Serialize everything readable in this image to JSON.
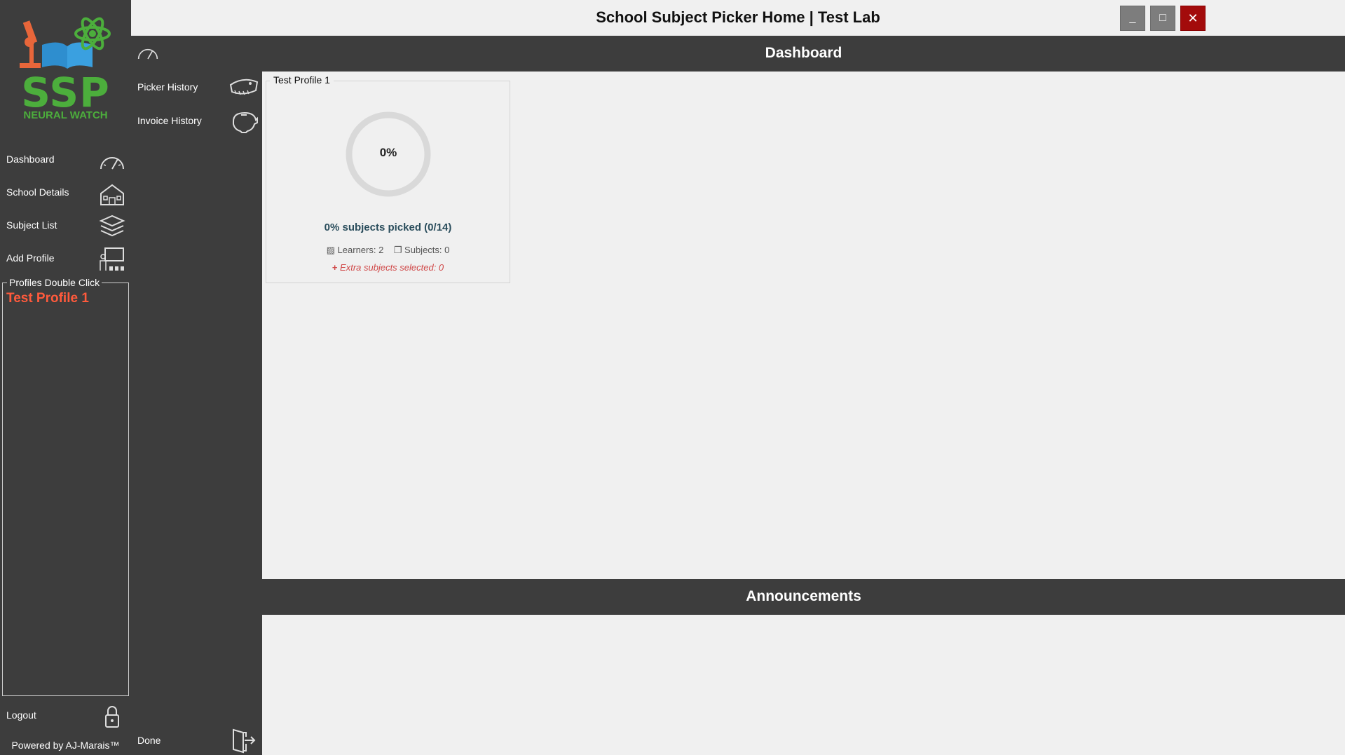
{
  "window": {
    "title": "School Subject Picker Home | Test Lab",
    "minimize_label": "_",
    "maximize_label": "□",
    "close_label": "✕"
  },
  "logo": {
    "title": "SSP",
    "subtitle": "NEURAL WATCH"
  },
  "sidebar": {
    "items": [
      {
        "label": "Dashboard",
        "icon": "speedometer-icon"
      },
      {
        "label": "School Details",
        "icon": "school-building-icon"
      },
      {
        "label": "Subject List",
        "icon": "stacked-books-icon"
      },
      {
        "label": "Add Profile",
        "icon": "teacher-classroom-icon"
      }
    ],
    "profiles_legend": "Profiles Double Click",
    "profiles": [
      "Test Profile 1"
    ],
    "logout_label": "Logout",
    "powered_by": "Powered by AJ-Marais™"
  },
  "subnav": {
    "items": [
      {
        "label": "Picker History",
        "icon": "dinosaur-skull-icon"
      },
      {
        "label": "Invoice History",
        "icon": "piggy-bank-icon"
      }
    ],
    "done_label": "Done"
  },
  "dashboard": {
    "title": "Dashboard",
    "card": {
      "legend": "Test Profile 1",
      "progress_text": "0%",
      "progress_fraction": 0,
      "picked_text": "0% subjects picked (0/14)",
      "learners_text": "Learners: 2",
      "subjects_text": "Subjects: 0",
      "extra_text": "Extra subjects selected: 0"
    }
  },
  "announcements": {
    "title": "Announcements"
  },
  "colors": {
    "sidebar_bg": "#3d3d3d",
    "logo_green": "#4cae3c",
    "profile_red": "#ff5a3c",
    "close_red": "#a30b0b",
    "content_bg": "#f0f0f0"
  }
}
